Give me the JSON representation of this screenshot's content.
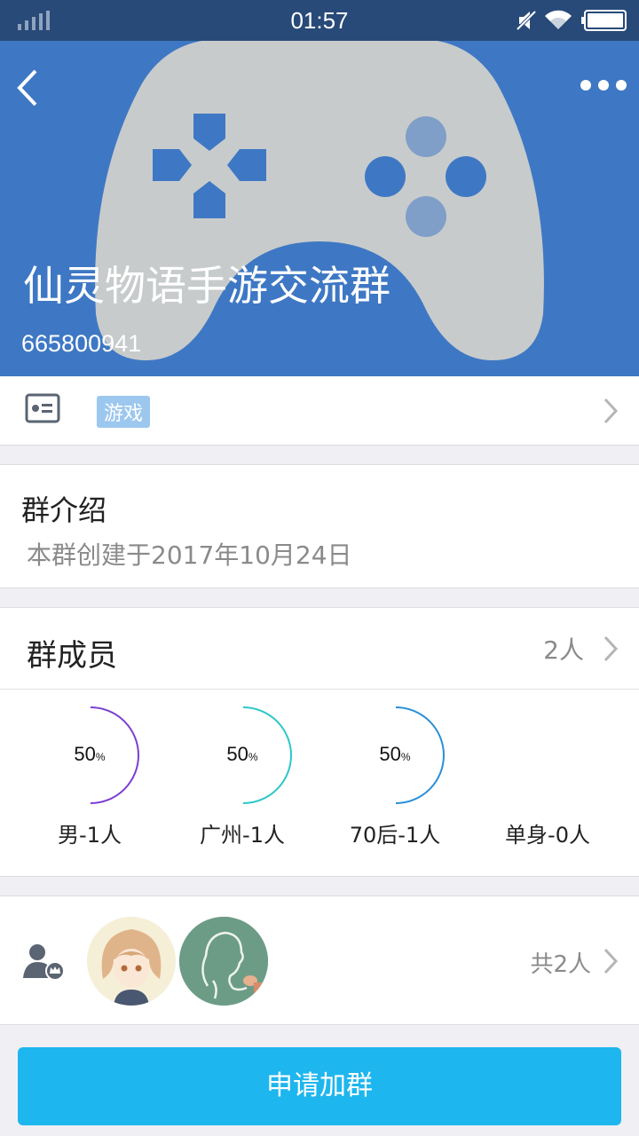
{
  "status_bar": {
    "time": "01:57"
  },
  "header": {
    "title": "仙灵物语手游交流群",
    "group_id": "665800941",
    "bg_color": "#3e78c4"
  },
  "category": {
    "tag": "游戏"
  },
  "intro": {
    "title": "群介绍",
    "text": "本群创建于2017年10月24日"
  },
  "members": {
    "title": "群成员",
    "count": "2人",
    "stats": [
      {
        "percent": "50",
        "unit": "%",
        "label": "男-1人",
        "color": "#7b3fd1",
        "fraction": 0.5
      },
      {
        "percent": "50",
        "unit": "%",
        "label": "广州-1人",
        "color": "#2cc7c9",
        "fraction": 0.5
      },
      {
        "percent": "50",
        "unit": "%",
        "label": "70后-1人",
        "color": "#2a8fd8",
        "fraction": 0.5
      },
      {
        "percent": "",
        "unit": "",
        "label": "单身-0人",
        "color": "#eeeeee",
        "fraction": 0
      }
    ]
  },
  "member_list": {
    "total": "共2人"
  },
  "join_button": {
    "label": "申请加群",
    "color": "#1eb6ee"
  }
}
